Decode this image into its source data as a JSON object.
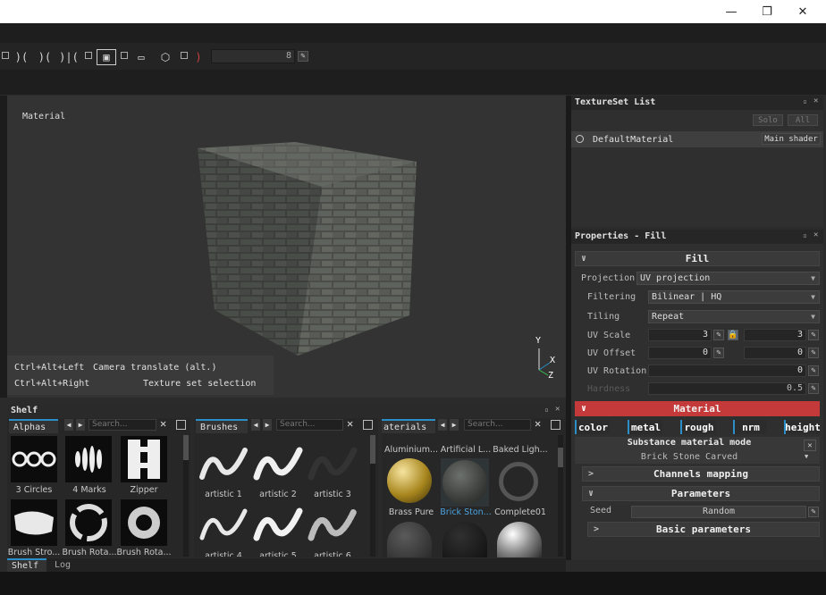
{
  "window": {
    "minimize": "—",
    "maximize": "❐",
    "close": "✕"
  },
  "toolbar": {
    "slider_value": "8"
  },
  "viewport": {
    "label": "Material",
    "hints": [
      {
        "keys": "Ctrl+Alt+Left",
        "action": "Camera translate (alt.)"
      },
      {
        "keys": "Ctrl+Alt+Right",
        "action": "Texture set selection"
      }
    ],
    "gizmo": {
      "y": "Y",
      "x": "X",
      "z": "Z"
    }
  },
  "texture_set_list": {
    "title": "TextureSet List",
    "solo": "Solo",
    "all": "All",
    "item": "DefaultMaterial",
    "shader": "Main shader"
  },
  "properties": {
    "title": "Properties - Fill",
    "fill_section": "Fill",
    "projection_label": "Projection",
    "projection_value": "UV projection",
    "filtering_label": "Filtering",
    "filtering_value": "Bilinear | HQ",
    "tiling_label": "Tiling",
    "tiling_value": "Repeat",
    "uv_scale_label": "UV Scale",
    "uv_scale_u": "3",
    "uv_scale_v": "3",
    "uv_offset_label": "UV Offset",
    "uv_offset_u": "0",
    "uv_offset_v": "0",
    "uv_rotation_label": "UV Rotation",
    "uv_rotation_value": "0",
    "hardness_label": "Hardness",
    "hardness_value": "0.5",
    "material_section": "Material",
    "channels": [
      "color",
      "metal",
      "rough",
      "nrm",
      "height"
    ],
    "substance_mode": "Substance material mode",
    "substance_name": "Brick Stone Carved",
    "channels_mapping": "Channels mapping",
    "parameters": "Parameters",
    "seed_label": "Seed",
    "seed_value": "Random",
    "basic_parameters": "Basic parameters"
  },
  "shelf": {
    "title": "Shelf",
    "search_placeholder": "Search...",
    "alphas": {
      "tab": "Alphas",
      "items": [
        "3 Circles",
        "4 Marks",
        "Zipper",
        "Brush Stro...",
        "Brush Rota...",
        "Brush Rota..."
      ]
    },
    "brushes": {
      "tab": "Brushes",
      "items": [
        "artistic 1",
        "artistic 2",
        "artistic 3",
        "artistic 4",
        "artistic 5",
        "artistic 6"
      ]
    },
    "materials": {
      "tab": "aterials",
      "items": [
        "Aluminium...",
        "Artificial L...",
        "Baked Ligh...",
        "Brass Pure",
        "Brick Ston...",
        "Complete01"
      ]
    },
    "bottom_tabs": [
      "Shelf",
      "Log"
    ]
  },
  "colors": {
    "accent_blue": "#2b8ec6",
    "material_red": "#c43a3a",
    "selected_text": "#4aa3e0"
  }
}
